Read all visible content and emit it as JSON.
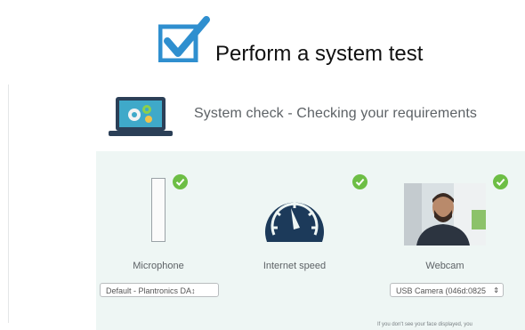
{
  "header": {
    "title": "Perform a system test",
    "checkbox_icon": "checkbox-checked-icon"
  },
  "system_check": {
    "title": "System check - Checking your requirements",
    "icon": "laptop-gears-icon"
  },
  "devices": {
    "microphone": {
      "label": "Microphone",
      "select_value": "Default - Plantronics DA↕",
      "status": "ok"
    },
    "internet": {
      "label": "Internet speed",
      "status": "ok"
    },
    "webcam": {
      "label": "Webcam",
      "select_value": "USB Camera (046d:0825",
      "status": "ok"
    }
  },
  "footnote": "If you don't see your face displayed, you",
  "colors": {
    "accent_blue": "#2f8fcf",
    "navy": "#1c3a5a",
    "success_green": "#6dbe45",
    "panel_bg": "#eef6f4"
  }
}
